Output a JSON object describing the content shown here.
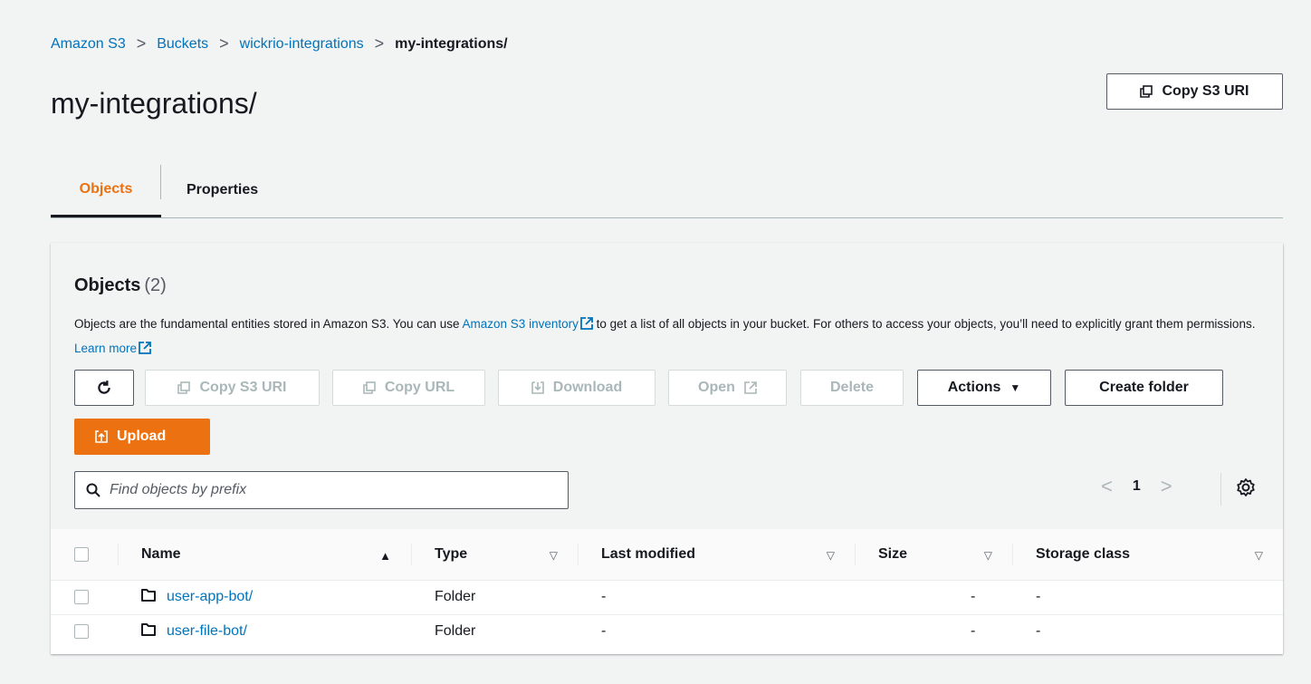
{
  "breadcrumb": {
    "items": [
      "Amazon S3",
      "Buckets",
      "wickrio-integrations"
    ],
    "current": "my-integrations/"
  },
  "page": {
    "title": "my-integrations/",
    "copy_uri_label": "Copy S3 URI"
  },
  "tabs": [
    "Objects",
    "Properties"
  ],
  "objects_panel": {
    "title": "Objects",
    "count": "(2)",
    "desc_part1": "Objects are the fundamental entities stored in Amazon S3. You can use ",
    "inventory_link": "Amazon S3 inventory",
    "desc_part2": " to get a list of all objects in your bucket. For others to access your objects, you’ll need to explicitly grant them permissions. ",
    "learn_more": "Learn more"
  },
  "toolbar": {
    "copy_s3_uri": "Copy S3 URI",
    "copy_url": "Copy URL",
    "download": "Download",
    "open": "Open",
    "delete": "Delete",
    "actions": "Actions",
    "create_folder": "Create folder",
    "upload": "Upload"
  },
  "search": {
    "placeholder": "Find objects by prefix",
    "value": ""
  },
  "pagination": {
    "current_page": "1"
  },
  "table": {
    "headers": [
      "Name",
      "Type",
      "Last modified",
      "Size",
      "Storage class"
    ],
    "rows": [
      {
        "name": "user-app-bot/",
        "type": "Folder",
        "last_modified": "-",
        "size": "-",
        "storage_class": "-"
      },
      {
        "name": "user-file-bot/",
        "type": "Folder",
        "last_modified": "-",
        "size": "-",
        "storage_class": "-"
      }
    ]
  },
  "colors": {
    "accent": "#ec7211",
    "link": "#0073bb",
    "text": "#16191f",
    "disabled": "#aab7b8"
  },
  "icons": [
    "refresh-icon",
    "copy-icon",
    "download-icon",
    "external-link-icon",
    "caret-down-icon",
    "upload-icon",
    "search-icon",
    "settings-icon",
    "folder-icon",
    "sort-ascending-icon",
    "sort-icon"
  ]
}
